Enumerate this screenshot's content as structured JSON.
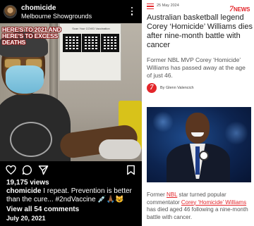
{
  "instagram": {
    "username": "chomicide",
    "location": "Melbourne Showgrounds",
    "overlay_text": "HERE'S TO 2021 AND HERE'S TO EXCESS DEATHS",
    "board_text": "Scan Your COVID Vaccination",
    "likes": "19,175 views",
    "caption_user": "chomicide",
    "caption_text": " I repeat. Prevention is better than the cure... #2ndVaccine 💉🙏🏾😺",
    "comments_link": "View all 54 comments",
    "date": "July 20, 2021",
    "icons": [
      "heart-icon",
      "comment-icon",
      "share-icon",
      "bookmark-icon",
      "mute-icon",
      "more-icon"
    ]
  },
  "news": {
    "date": "25 May 2024",
    "logo_number": "7",
    "logo_word": "NEWS",
    "headline": "Australian basketball legend Corey ‘Homicide’ Williams dies after nine-month battle with cancer",
    "standfirst": "Former NBL MVP Corey ‘Homicide’ Williams has passed away at the age of just 46.",
    "author": "By Glenn Valencich",
    "author_logo": "7",
    "body_part1": "Former ",
    "body_link1": "NBL",
    "body_part2": " star turned popular commentator ",
    "body_link2": "Corey ‘Homicide’ Williams",
    "body_part3": " has died aged 46 following a nine-month battle with cancer.",
    "accent_color": "#e3262b"
  }
}
